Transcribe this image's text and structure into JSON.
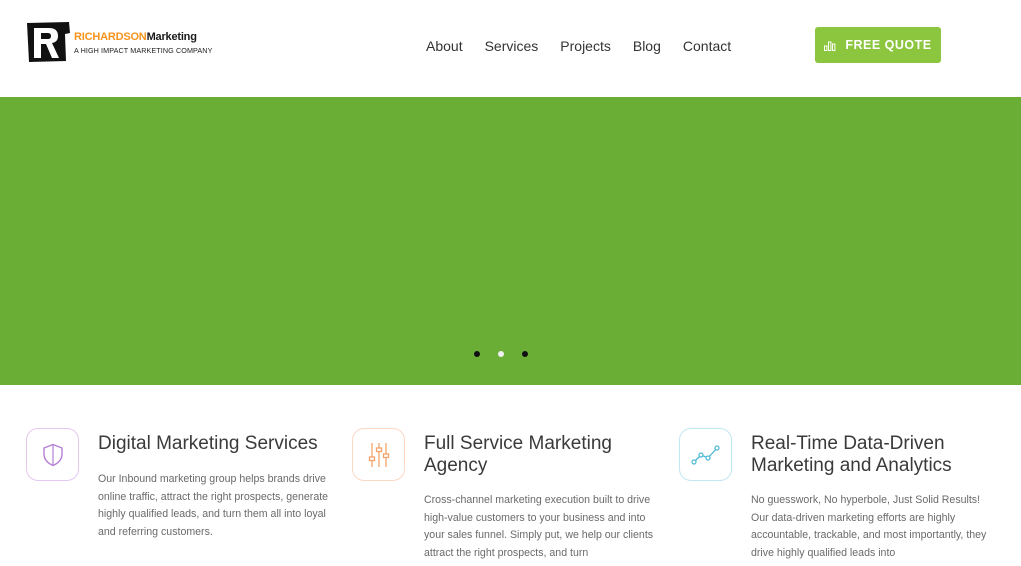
{
  "brand": {
    "name_part1": "RICHARDSON",
    "name_part2": "Marketing",
    "tagline": "A HIGH IMPACT MARKETING COMPANY",
    "logo_letter": "R",
    "colors": {
      "orange": "#f7941d",
      "green": "#8cc63f",
      "hero": "#6aae36"
    }
  },
  "nav": {
    "items": [
      {
        "label": "About"
      },
      {
        "label": "Services"
      },
      {
        "label": "Projects"
      },
      {
        "label": "Blog"
      },
      {
        "label": "Contact"
      }
    ]
  },
  "cta": {
    "label": "FREE QUOTE",
    "icon": "bar-chart-icon"
  },
  "slider": {
    "slides": 3,
    "active_index": 2
  },
  "features": [
    {
      "icon": "shield-icon",
      "title": "Digital Marketing Services",
      "text": "Our Inbound marketing group helps brands drive online traffic, attract the right prospects, generate highly qualified leads, and turn them all into loyal and referring customers."
    },
    {
      "icon": "sliders-icon",
      "title": "Full Service Marketing Agency",
      "text": "Cross-channel marketing execution built to drive high-value customers to your business and into your sales funnel. Simply put, we help our clients attract the right prospects, and turn"
    },
    {
      "icon": "line-chart-icon",
      "title": "Real-Time Data-Driven Marketing and Analytics",
      "text": "No guesswork, No hyperbole, Just Solid Results! Our data-driven marketing efforts are highly accountable, trackable, and most importantly, they drive highly qualified leads into"
    }
  ]
}
